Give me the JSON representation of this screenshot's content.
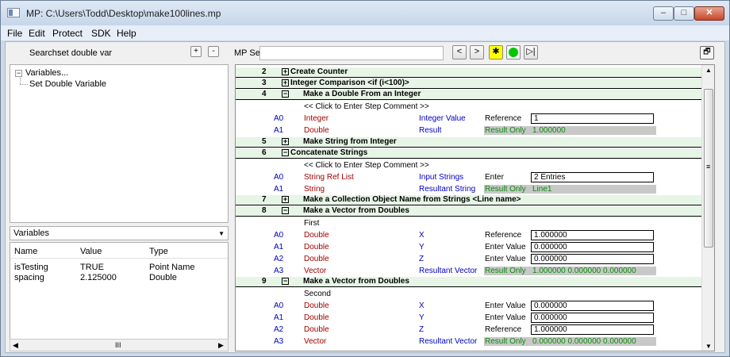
{
  "window": {
    "title": "MP: C:\\Users\\Todd\\Desktop\\make100lines.mp",
    "min_glyph": "–",
    "max_glyph": "□",
    "close_glyph": "✕"
  },
  "menu": [
    {
      "label": "File"
    },
    {
      "label": "Edit"
    },
    {
      "label": "Protect"
    },
    {
      "label": "SDK"
    },
    {
      "label": "Help"
    }
  ],
  "left": {
    "search_label": "Search:",
    "search_value": "set double var",
    "plus": "+",
    "minus": "-",
    "tree": {
      "root": "Variables...",
      "child": "Set Double Variable",
      "collapse_glyph": "−"
    },
    "dropdown": "Variables",
    "dropdown_arrow": "▼",
    "columns": [
      "Name",
      "Value",
      "Type"
    ],
    "rows": [
      {
        "name": "isTesting",
        "value": "TRUE",
        "type": "Point Name"
      },
      {
        "name": "spacing",
        "value": "2.125000",
        "type": "Double"
      }
    ],
    "hscroll_left": "◀",
    "hscroll_grip": "III",
    "hscroll_right": "▶"
  },
  "right": {
    "search_label": "MP Search:",
    "nav_prev": "<",
    "nav_next": ">",
    "bug_glyph": "✱",
    "run_to_glyph": "▷|",
    "window_glyph": "🗗",
    "scroll_up": "▲",
    "scroll_mid": "≡",
    "scroll_down": "▼",
    "pointer_glyph": "⇨"
  },
  "steps": [
    {
      "num": "2",
      "box": "+",
      "title": "Create Counter"
    },
    {
      "num": "3",
      "box": "+",
      "title": "Integer Comparison    <if (i<100)>"
    },
    {
      "num": "4",
      "box": "−",
      "title": "Make a Double From an Integer",
      "comment": "<< Click to Enter Step Comment >>",
      "params": [
        {
          "a": "A0",
          "type": "Integer",
          "desc": "Integer Value",
          "mode": "Reference",
          "value": "1"
        },
        {
          "a": "A1",
          "type": "Double",
          "desc": "Result",
          "mode": "Result Only",
          "value": "1.000000"
        }
      ]
    },
    {
      "num": "5",
      "box": "+",
      "title": "Make String from Integer"
    },
    {
      "num": "6",
      "box": "−",
      "title": "Concatenate Strings",
      "comment": "<< Click to Enter Step Comment >>",
      "params": [
        {
          "a": "A0",
          "type": "String Ref List",
          "desc": "Input Strings",
          "mode": "Enter",
          "value": "2 Entries"
        },
        {
          "a": "A1",
          "type": "String",
          "desc": "Resultant String",
          "mode": "Result Only",
          "value": "Line1"
        }
      ]
    },
    {
      "num": "7",
      "box": "+",
      "title": "Make a Collection Object Name from Strings    <Line name>"
    },
    {
      "num": "8",
      "box": "−",
      "title": "Make a Vector from Doubles",
      "comment": "First",
      "params": [
        {
          "a": "A0",
          "type": "Double",
          "desc": "X",
          "mode": "Reference",
          "value": "1.000000"
        },
        {
          "a": "A1",
          "type": "Double",
          "desc": "Y",
          "mode": "Enter Value",
          "value": "0.000000"
        },
        {
          "a": "A2",
          "type": "Double",
          "desc": "Z",
          "mode": "Enter Value",
          "value": "0.000000"
        },
        {
          "a": "A3",
          "type": "Vector",
          "desc": "Resultant Vector",
          "mode": "Result Only",
          "value": "1.000000 0.000000 0.000000"
        }
      ]
    },
    {
      "num": "9",
      "box": "−",
      "title": "Make a Vector from Doubles",
      "comment": "Second",
      "params": [
        {
          "a": "A0",
          "type": "Double",
          "desc": "X",
          "mode": "Enter Value",
          "value": "0.000000"
        },
        {
          "a": "A1",
          "type": "Double",
          "desc": "Y",
          "mode": "Enter Value",
          "value": "0.000000"
        },
        {
          "a": "A2",
          "type": "Double",
          "desc": "Z",
          "mode": "Reference",
          "value": "1.000000"
        },
        {
          "a": "A3",
          "type": "Vector",
          "desc": "Resultant Vector",
          "mode": "Result Only",
          "value": "0.000000 0.000000 0.000000"
        }
      ]
    }
  ],
  "colors": {
    "header_bg": "#e6f5e6",
    "param_blue": "#0000c0",
    "param_red": "#a00000",
    "result_green": "#0a8a0a",
    "result_bg": "#c8c8c8"
  }
}
